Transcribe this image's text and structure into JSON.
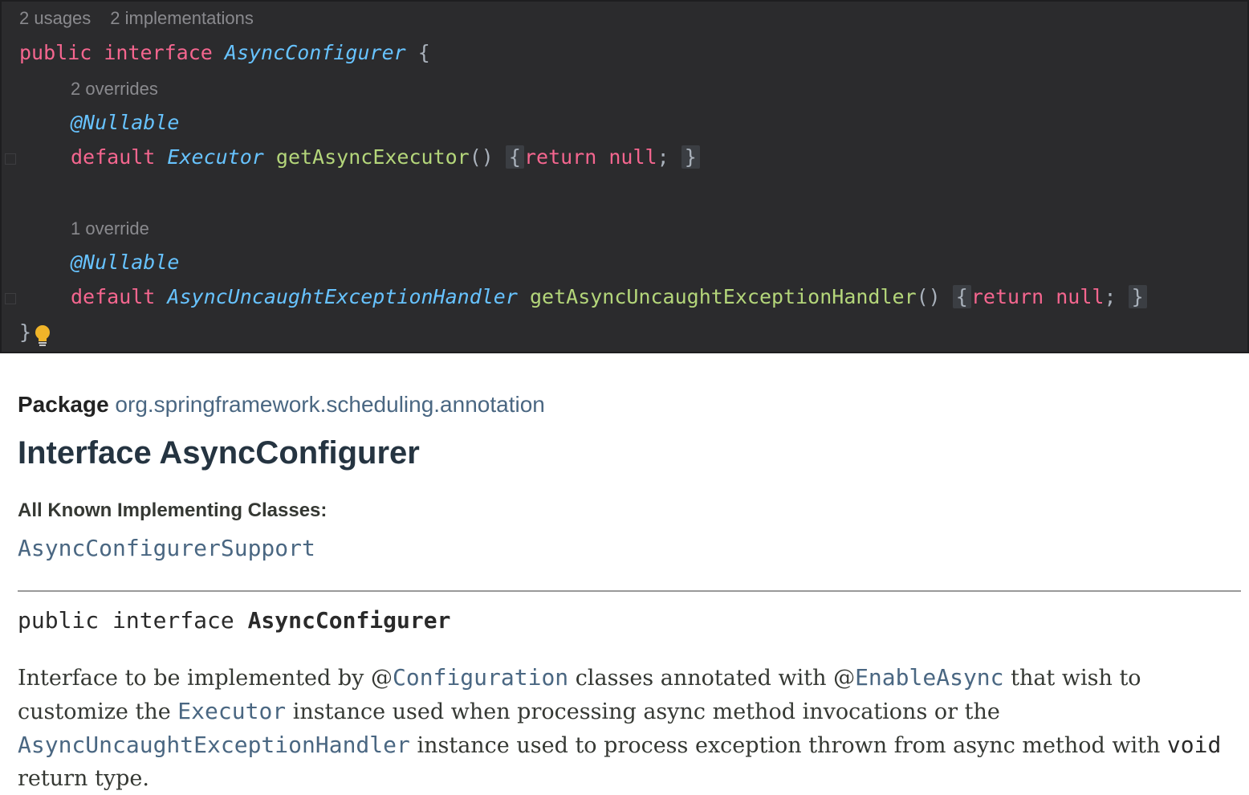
{
  "editor": {
    "hint1": {
      "usages": "2 usages",
      "implementations": "2 implementations"
    },
    "line1": {
      "kw1": "public",
      "kw2": "interface",
      "name": "AsyncConfigurer",
      "brace": "{"
    },
    "hint2": "2 overrides",
    "ann1": "@Nullable",
    "method1": {
      "kw": "default",
      "type": "Executor",
      "name": "getAsyncExecutor",
      "parens": "()",
      "open": "{",
      "ret": "return",
      "nul": "null",
      "semi": ";",
      "close": "}"
    },
    "hint3": "1 override",
    "ann2": "@Nullable",
    "method2": {
      "kw": "default",
      "type": "AsyncUncaughtExceptionHandler",
      "name": "getAsyncUncaughtExceptionHandler",
      "parens": "()",
      "open": "{",
      "ret": "return",
      "nul": "null",
      "semi": ";",
      "close": "}"
    },
    "closing": "}",
    "bulb_icon": "lightbulb-icon"
  },
  "javadoc": {
    "package_label": "Package",
    "package_name": "org.springframework.scheduling.annotation",
    "title": "Interface AsyncConfigurer",
    "implementing_label": "All Known Implementing Classes:",
    "implementing_class": "AsyncConfigurerSupport",
    "signature": {
      "prefix": "public interface ",
      "name": "AsyncConfigurer"
    },
    "description": {
      "t1": "Interface to be implemented by @",
      "l1": "Configuration",
      "t2": " classes annotated with @",
      "l2": "EnableAsync",
      "t3": " that wish to customize the ",
      "l3": "Executor",
      "t4": "  instance used when processing async method invocations or the ",
      "l4": "AsyncUncaughtExceptionHandler",
      "t5": " instance used to process exception thrown from async method with ",
      "c1": "void",
      "t6": " return type."
    }
  },
  "colors": {
    "editor_bg": "#2b2b2d",
    "keyword": "#f5668f",
    "type": "#67c3ff",
    "function": "#b4d67a",
    "hint": "#8a8a8e",
    "link": "#4a6782",
    "title": "#253441"
  }
}
